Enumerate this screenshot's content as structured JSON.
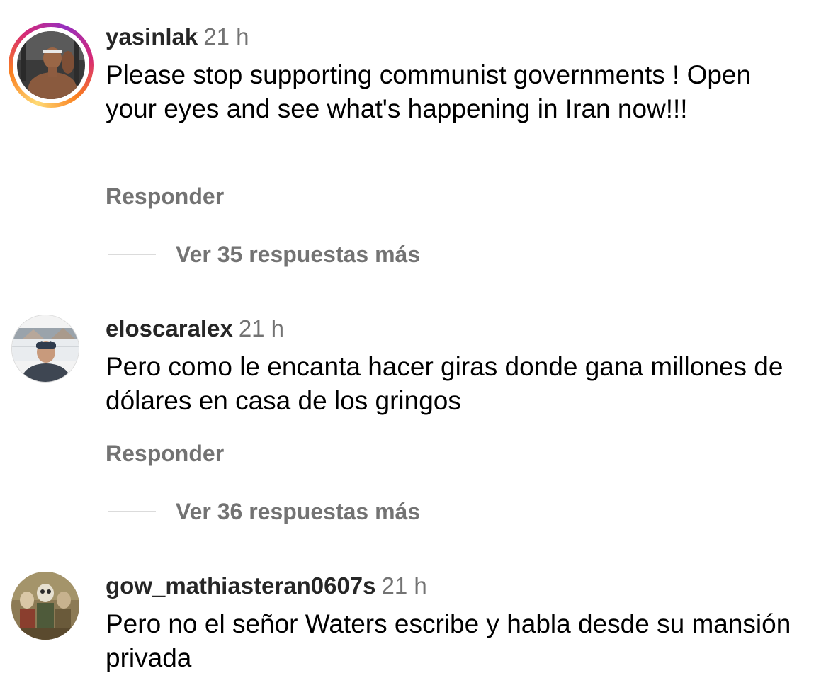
{
  "comments": [
    {
      "username": "yasinlak",
      "time": "21 h",
      "text": "Please stop supporting communist governments ! Open your eyes and see what's happening in Iran now!!!",
      "reply_label": "Responder",
      "view_replies_label": "Ver 35 respuestas más",
      "has_story_ring": true
    },
    {
      "username": "eloscaralex",
      "time": "21 h",
      "text": "Pero como le encanta hacer giras donde gana millones de dólares en casa de los gringos",
      "reply_label": "Responder",
      "view_replies_label": "Ver 36 respuestas más",
      "has_story_ring": false
    },
    {
      "username": "gow_mathiasteran0607s",
      "time": "21 h",
      "text": "Pero no el señor Waters escribe y habla desde su mansión privada",
      "has_story_ring": false
    }
  ],
  "colors": {
    "secondary_text": "#737373",
    "primary_text": "#000000",
    "divider": "#dbdbdb"
  }
}
